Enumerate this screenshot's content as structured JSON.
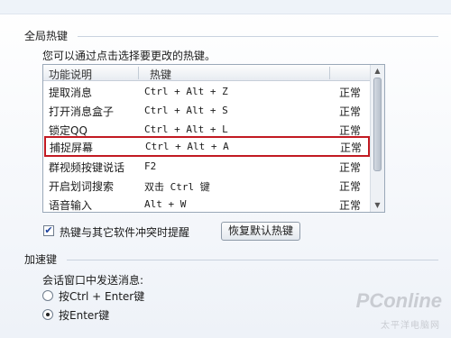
{
  "sections": {
    "global_hotkeys": "全局热键",
    "accelerator_keys": "加速键"
  },
  "hint": "您可以通过点击选择要更改的热键。",
  "table": {
    "headers": [
      "功能说明",
      "热键"
    ],
    "rows": [
      {
        "name": "提取消息",
        "key": "Ctrl + Alt + Z",
        "status": "正常"
      },
      {
        "name": "打开消息盒子",
        "key": "Ctrl + Alt + S",
        "status": "正常"
      },
      {
        "name": "锁定QQ",
        "key": "Ctrl + Alt + L",
        "status": "正常"
      },
      {
        "name": "捕捉屏幕",
        "key": "Ctrl + Alt + A",
        "status": "正常"
      },
      {
        "name": "群视频按键说话",
        "key": "F2",
        "status": "正常"
      },
      {
        "name": "开启划词搜索",
        "key": "双击 Ctrl 键",
        "status": "正常"
      },
      {
        "name": "语音输入",
        "key": "Alt + W",
        "status": "正常"
      }
    ]
  },
  "conflict_checkbox": {
    "label": "热键与其它软件冲突时提醒",
    "checked": true
  },
  "restore_button": "恢复默认热键",
  "send_message": {
    "label": "会话窗口中发送消息:",
    "options": [
      {
        "label": "按Ctrl + Enter键",
        "selected": false
      },
      {
        "label": "按Enter键",
        "selected": true
      }
    ]
  },
  "watermark": {
    "brand": "PConline",
    "sub": "太平洋电脑网"
  },
  "colors": {
    "highlight_border": "#c21a22",
    "section_line": "#c9d3df"
  }
}
